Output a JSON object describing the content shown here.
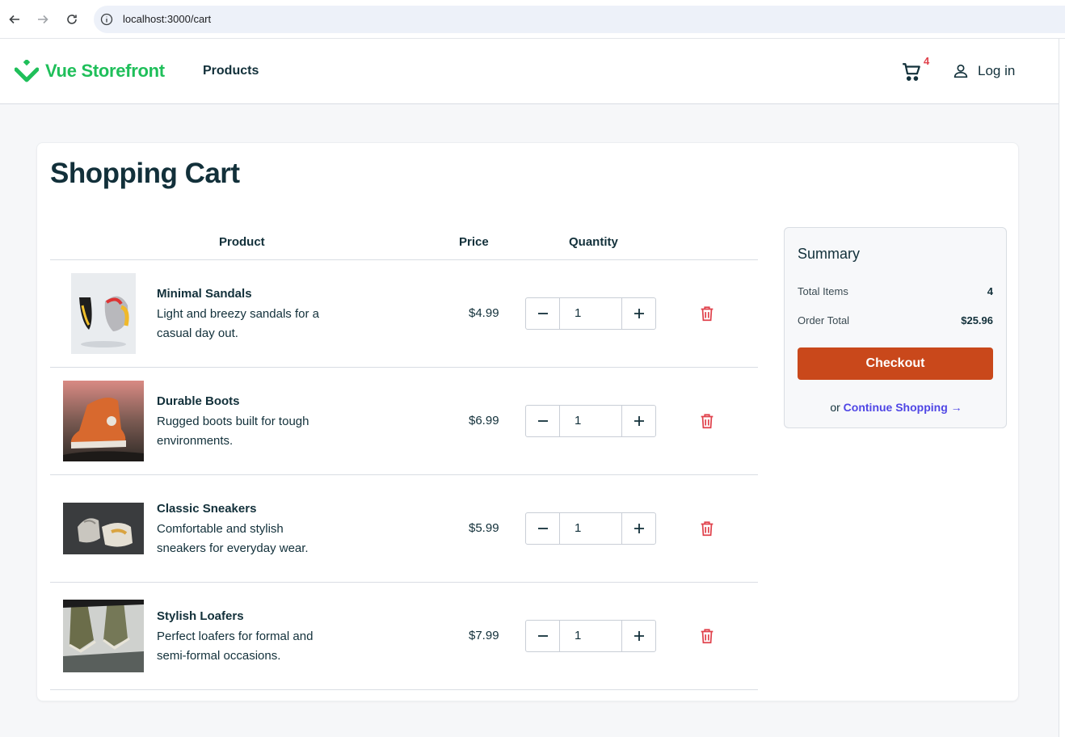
{
  "browser": {
    "url": "localhost:3000/cart"
  },
  "header": {
    "logo_text": "Vue Storefront",
    "nav_products": "Products",
    "cart_count": "4",
    "login_label": "Log in",
    "brand_color": "#1fbf5a"
  },
  "cart": {
    "title": "Shopping Cart",
    "columns": {
      "product": "Product",
      "price": "Price",
      "quantity": "Quantity"
    },
    "items": [
      {
        "name": "Minimal Sandals",
        "description": "Light and breezy sandals for a casual day out.",
        "price": "$4.99",
        "quantity": "1"
      },
      {
        "name": "Durable Boots",
        "description": "Rugged boots built for tough environments.",
        "price": "$6.99",
        "quantity": "1"
      },
      {
        "name": "Classic Sneakers",
        "description": "Comfortable and stylish sneakers for everyday wear.",
        "price": "$5.99",
        "quantity": "1"
      },
      {
        "name": "Stylish Loafers",
        "description": "Perfect loafers for formal and semi-formal occasions.",
        "price": "$7.99",
        "quantity": "1"
      }
    ]
  },
  "summary": {
    "title": "Summary",
    "total_items_label": "Total Items",
    "total_items_value": "4",
    "order_total_label": "Order Total",
    "order_total_value": "$25.96",
    "checkout_label": "Checkout",
    "or_text": "or",
    "continue_label": "Continue Shopping →",
    "checkout_color": "#c9481b",
    "link_color": "#4f46e5",
    "delete_color": "#e0424c"
  }
}
